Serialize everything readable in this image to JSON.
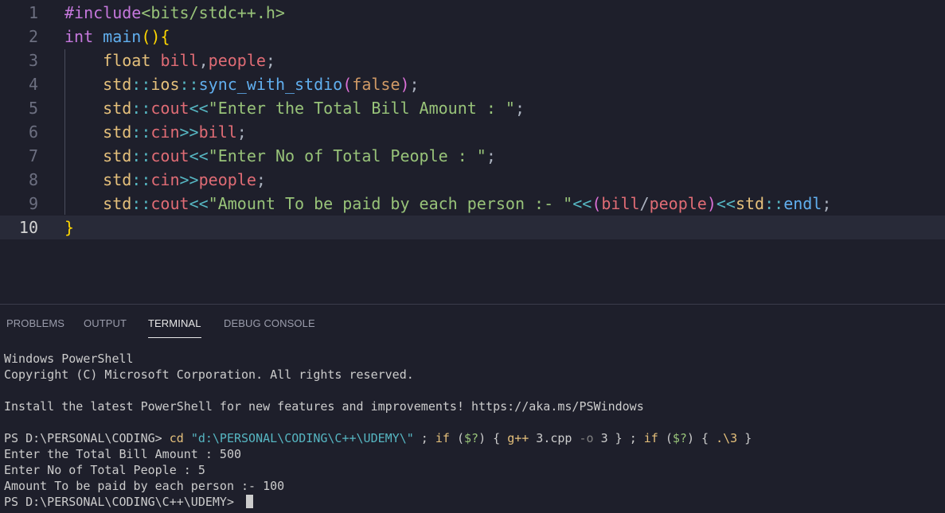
{
  "editor": {
    "active_line": 10,
    "lines": [
      {
        "num": "1",
        "tokens": [
          [
            "#include",
            "pre"
          ],
          [
            "<bits/stdc++.h>",
            "inc"
          ]
        ]
      },
      {
        "num": "2",
        "tokens": [
          [
            "int",
            "kw"
          ],
          [
            " ",
            "plain"
          ],
          [
            "main",
            "fn"
          ],
          [
            "()",
            "brace"
          ],
          [
            "{",
            "brace"
          ]
        ]
      },
      {
        "num": "3",
        "tokens": [
          [
            "    ",
            "plain"
          ],
          [
            "float",
            "ns"
          ],
          [
            " ",
            "plain"
          ],
          [
            "bill",
            "var"
          ],
          [
            ",",
            "plain"
          ],
          [
            "people",
            "var"
          ],
          [
            ";",
            "plain"
          ]
        ]
      },
      {
        "num": "4",
        "tokens": [
          [
            "    ",
            "plain"
          ],
          [
            "std",
            "ns"
          ],
          [
            "::",
            "punc"
          ],
          [
            "ios",
            "ns"
          ],
          [
            "::",
            "punc"
          ],
          [
            "sync_with_stdio",
            "fn"
          ],
          [
            "(",
            "paren"
          ],
          [
            "false",
            "bool"
          ],
          [
            ")",
            "paren"
          ],
          [
            ";",
            "plain"
          ]
        ]
      },
      {
        "num": "5",
        "tokens": [
          [
            "    ",
            "plain"
          ],
          [
            "std",
            "ns"
          ],
          [
            "::",
            "punc"
          ],
          [
            "cout",
            "var"
          ],
          [
            "<<",
            "punc"
          ],
          [
            "\"Enter the Total Bill Amount : \"",
            "str"
          ],
          [
            ";",
            "plain"
          ]
        ]
      },
      {
        "num": "6",
        "tokens": [
          [
            "    ",
            "plain"
          ],
          [
            "std",
            "ns"
          ],
          [
            "::",
            "punc"
          ],
          [
            "cin",
            "var"
          ],
          [
            ">>",
            "punc"
          ],
          [
            "bill",
            "var"
          ],
          [
            ";",
            "plain"
          ]
        ]
      },
      {
        "num": "7",
        "tokens": [
          [
            "    ",
            "plain"
          ],
          [
            "std",
            "ns"
          ],
          [
            "::",
            "punc"
          ],
          [
            "cout",
            "var"
          ],
          [
            "<<",
            "punc"
          ],
          [
            "\"Enter No of Total People : \"",
            "str"
          ],
          [
            ";",
            "plain"
          ]
        ]
      },
      {
        "num": "8",
        "tokens": [
          [
            "    ",
            "plain"
          ],
          [
            "std",
            "ns"
          ],
          [
            "::",
            "punc"
          ],
          [
            "cin",
            "var"
          ],
          [
            ">>",
            "punc"
          ],
          [
            "people",
            "var"
          ],
          [
            ";",
            "plain"
          ]
        ]
      },
      {
        "num": "9",
        "tokens": [
          [
            "    ",
            "plain"
          ],
          [
            "std",
            "ns"
          ],
          [
            "::",
            "punc"
          ],
          [
            "cout",
            "var"
          ],
          [
            "<<",
            "punc"
          ],
          [
            "\"Amount To be paid by each person :- \"",
            "str"
          ],
          [
            "<<",
            "punc"
          ],
          [
            "(",
            "paren"
          ],
          [
            "bill",
            "var"
          ],
          [
            "/",
            "plain"
          ],
          [
            "people",
            "var"
          ],
          [
            ")",
            "paren"
          ],
          [
            "<<",
            "punc"
          ],
          [
            "std",
            "ns"
          ],
          [
            "::",
            "punc"
          ],
          [
            "endl",
            "id"
          ],
          [
            ";",
            "plain"
          ]
        ]
      },
      {
        "num": "10",
        "tokens": [
          [
            "}",
            "brace"
          ]
        ]
      }
    ]
  },
  "panel": {
    "tabs": [
      {
        "label": "PROBLEMS",
        "active": false
      },
      {
        "label": "OUTPUT",
        "active": false
      },
      {
        "label": "TERMINAL",
        "active": true
      },
      {
        "label": "DEBUG CONSOLE",
        "active": false
      }
    ]
  },
  "terminal": {
    "lines": [
      {
        "segments": [
          [
            "Windows PowerShell",
            "op"
          ]
        ]
      },
      {
        "segments": [
          [
            "Copyright (C) Microsoft Corporation. All rights reserved.",
            "op"
          ]
        ]
      },
      {
        "segments": [
          [
            "",
            "op"
          ]
        ]
      },
      {
        "segments": [
          [
            "Install the latest PowerShell for new features and improvements! https://aka.ms/PSWindows",
            "op"
          ]
        ]
      },
      {
        "segments": [
          [
            "",
            "op"
          ]
        ]
      },
      {
        "segments": [
          [
            "PS D:\\PERSONAL\\CODING> ",
            "op"
          ],
          [
            "cd",
            "cmd"
          ],
          [
            " ",
            "op"
          ],
          [
            "\"d:\\PERSONAL\\CODING\\C++\\UDEMY\\\"",
            "str"
          ],
          [
            " ; ",
            "op"
          ],
          [
            "if",
            "kw"
          ],
          [
            " (",
            "op"
          ],
          [
            "$?",
            "var"
          ],
          [
            ") { ",
            "op"
          ],
          [
            "g++",
            "cmd"
          ],
          [
            " 3.cpp ",
            "op"
          ],
          [
            "-o",
            "param"
          ],
          [
            " 3 } ; ",
            "op"
          ],
          [
            "if",
            "kw"
          ],
          [
            " (",
            "op"
          ],
          [
            "$?",
            "var"
          ],
          [
            ") { ",
            "op"
          ],
          [
            ".\\3",
            "cmd"
          ],
          [
            " }",
            "op"
          ]
        ]
      },
      {
        "segments": [
          [
            "Enter the Total Bill Amount : 500",
            "op"
          ]
        ]
      },
      {
        "segments": [
          [
            "Enter No of Total People : 5",
            "op"
          ]
        ]
      },
      {
        "segments": [
          [
            "Amount To be paid by each person :- 100",
            "op"
          ]
        ]
      },
      {
        "segments": [
          [
            "PS D:\\PERSONAL\\CODING\\C++\\UDEMY> ",
            "op"
          ]
        ],
        "cursor": true
      }
    ]
  }
}
